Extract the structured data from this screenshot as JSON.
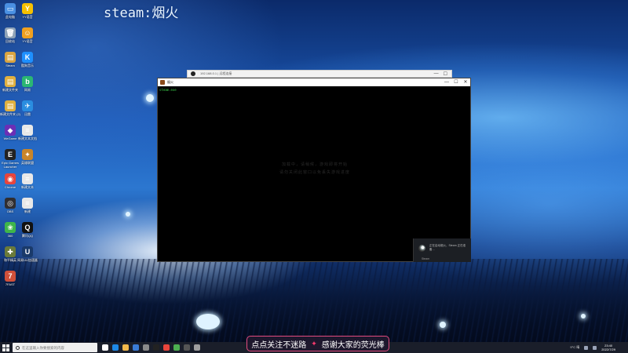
{
  "overlay": {
    "title": "steam:烟火"
  },
  "desktop_icons": [
    {
      "label": "此电脑",
      "color": "#4a90e2",
      "glyph": "▭",
      "icon": "computer-icon"
    },
    {
      "label": "YY语音",
      "color": "#f5c000",
      "glyph": "Y",
      "icon": "yy-icon"
    },
    {
      "label": "回收站",
      "color": "#8fa3b8",
      "glyph": "🗑",
      "icon": "recycle-bin-icon"
    },
    {
      "label": "YY语音",
      "color": "#f0a020",
      "glyph": "☺",
      "icon": "owl-icon"
    },
    {
      "label": "Steam",
      "color": "#d9a441",
      "glyph": "▤",
      "icon": "folder-icon"
    },
    {
      "label": "酷狗音乐",
      "color": "#1e90ff",
      "glyph": "K",
      "icon": "kugou-icon"
    },
    {
      "label": "新建文件夹",
      "color": "#e0b040",
      "glyph": "▤",
      "icon": "folder-icon"
    },
    {
      "label": "网易",
      "color": "#2bb673",
      "glyph": "b",
      "icon": "app-icon"
    },
    {
      "label": "新建文件夹 (2)",
      "color": "#e0b040",
      "glyph": "▤",
      "icon": "folder-icon"
    },
    {
      "label": "迅雷",
      "color": "#2a8de0",
      "glyph": "✈",
      "icon": "xunlei-icon"
    },
    {
      "label": "WeGame",
      "color": "#6b2fb5",
      "glyph": "◆",
      "icon": "wegame-icon"
    },
    {
      "label": "新建文本文档",
      "color": "#e8e8e8",
      "glyph": "≡",
      "icon": "text-file-icon"
    },
    {
      "label": "Epic Games Launcher",
      "color": "#222222",
      "glyph": "E",
      "icon": "epic-icon"
    },
    {
      "label": "英雄联盟",
      "color": "#c8852a",
      "glyph": "✦",
      "icon": "lol-icon"
    },
    {
      "label": "Chrome",
      "color": "#e8453c",
      "glyph": "◉",
      "icon": "chrome-icon"
    },
    {
      "label": "新建文本",
      "color": "#e8e8e8",
      "glyph": "≡",
      "icon": "text-file-icon"
    },
    {
      "label": "OBS",
      "color": "#302e31",
      "glyph": "◎",
      "icon": "obs-icon"
    },
    {
      "label": "新建",
      "color": "#e8e8e8",
      "glyph": "≡",
      "icon": "text-file-icon"
    },
    {
      "label": "360",
      "color": "#3fb54a",
      "glyph": "❀",
      "icon": "app-icon"
    },
    {
      "label": "腾讯QQ",
      "color": "#111111",
      "glyph": "Q",
      "icon": "qq-icon"
    },
    {
      "label": "和平精英",
      "color": "#6a7a3a",
      "glyph": "✚",
      "icon": "game-icon"
    },
    {
      "label": "网易UU加速器",
      "color": "#1a3a6a",
      "glyph": "U",
      "icon": "uu-icon"
    },
    {
      "label": "7FAST",
      "color": "#d0503a",
      "glyph": "7",
      "icon": "app-icon"
    }
  ],
  "bg_window": {
    "title": "192.168.0.1  |  远程连接"
  },
  "window": {
    "title": "烟火",
    "console_line": "steam.exe",
    "center_text_1": "加载中，请稍候，游戏即将开始",
    "center_text_2": "请勿关闭此窗口以免丢失游戏进度",
    "minimize": "—",
    "maximize": "☐",
    "close": "✕"
  },
  "notification": {
    "message": "正在启动烟火，Steam 正在准备…",
    "footer": "Steam"
  },
  "taskbar": {
    "search_placeholder": "在这里输入你要搜索的内容",
    "weather": "9°C 晴",
    "time": "23:40",
    "date": "2022/7/29",
    "apps": [
      {
        "color": "#ffffff",
        "icon": "task-view-icon"
      },
      {
        "color": "#1e88e5",
        "icon": "edge-icon"
      },
      {
        "color": "#f2b84b",
        "icon": "explorer-icon"
      },
      {
        "color": "#3a7bd5",
        "icon": "store-icon"
      },
      {
        "color": "#8a8a8a",
        "icon": "app-icon"
      },
      {
        "color": "#222222",
        "icon": "steam-icon"
      },
      {
        "color": "#e8453c",
        "icon": "chrome-icon"
      },
      {
        "color": "#4caf50",
        "icon": "app-icon"
      },
      {
        "color": "#555555",
        "icon": "obs-icon"
      },
      {
        "color": "#9e9e9e",
        "icon": "app-icon"
      }
    ]
  },
  "banner": {
    "left": "点点关注不迷路",
    "spark": "✦",
    "right": "感谢大家的荧光棒"
  }
}
